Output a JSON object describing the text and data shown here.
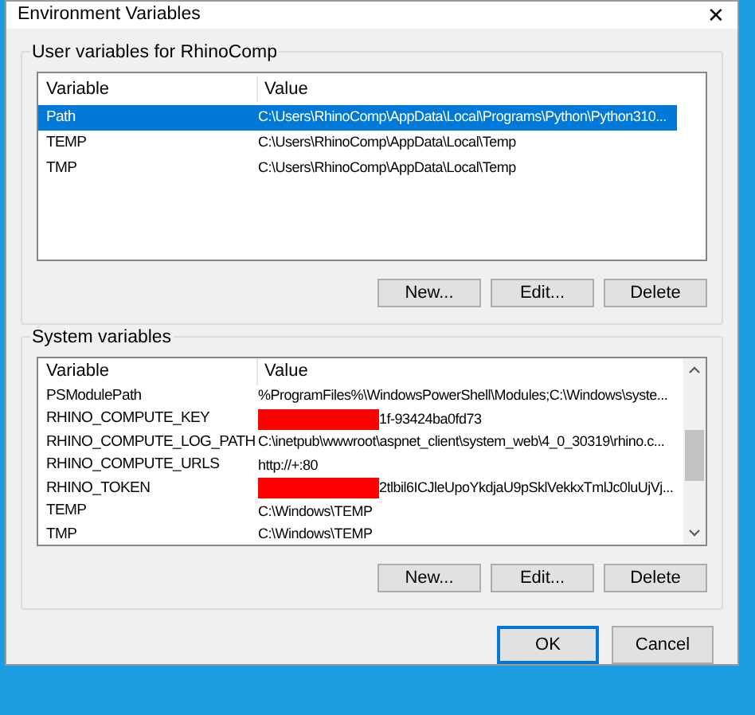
{
  "window": {
    "title": "Environment Variables",
    "close": "✕"
  },
  "user_variables": {
    "title": "User variables for RhinoComp",
    "columns": [
      "Variable",
      "Value"
    ],
    "rows": [
      {
        "variable": "Path",
        "value": "C:\\Users\\RhinoComp\\AppData\\Local\\Programs\\Python\\Python310...",
        "selected": true,
        "redacted": false
      },
      {
        "variable": "TEMP",
        "value": "C:\\Users\\RhinoComp\\AppData\\Local\\Temp",
        "selected": false,
        "redacted": false
      },
      {
        "variable": "TMP",
        "value": "C:\\Users\\RhinoComp\\AppData\\Local\\Temp",
        "selected": false,
        "redacted": false
      }
    ],
    "buttons": [
      "New...",
      "Edit...",
      "Delete"
    ]
  },
  "system_variables": {
    "title": "System variables",
    "columns": [
      "Variable",
      "Value"
    ],
    "rows": [
      {
        "variable": "PSModulePath",
        "value": "%ProgramFiles%\\WindowsPowerShell\\Modules;C:\\Windows\\syste...",
        "selected": false,
        "redacted": false
      },
      {
        "variable": "RHINO_COMPUTE_KEY",
        "value": "1f-93424ba0fd73",
        "selected": false,
        "redacted": true
      },
      {
        "variable": "RHINO_COMPUTE_LOG_PATH",
        "value": "C:\\inetpub\\wwwroot\\aspnet_client\\system_web\\4_0_30319\\rhino.c...",
        "selected": false,
        "redacted": false
      },
      {
        "variable": "RHINO_COMPUTE_URLS",
        "value": "http://+:80",
        "selected": false,
        "redacted": false
      },
      {
        "variable": "RHINO_TOKEN",
        "value": "2tlbil6ICJleUpoYkdjaU9pSklVekkxTmlJc0luUjVj...",
        "selected": false,
        "redacted": true
      },
      {
        "variable": "TEMP",
        "value": "C:\\Windows\\TEMP",
        "selected": false,
        "redacted": false
      },
      {
        "variable": "TMP",
        "value": "C:\\Windows\\TEMP",
        "selected": false,
        "redacted": false
      }
    ],
    "buttons": [
      "New...",
      "Edit...",
      "Delete"
    ]
  },
  "footer_buttons": [
    {
      "label": "OK",
      "default": true
    },
    {
      "label": "Cancel",
      "default": false
    }
  ]
}
